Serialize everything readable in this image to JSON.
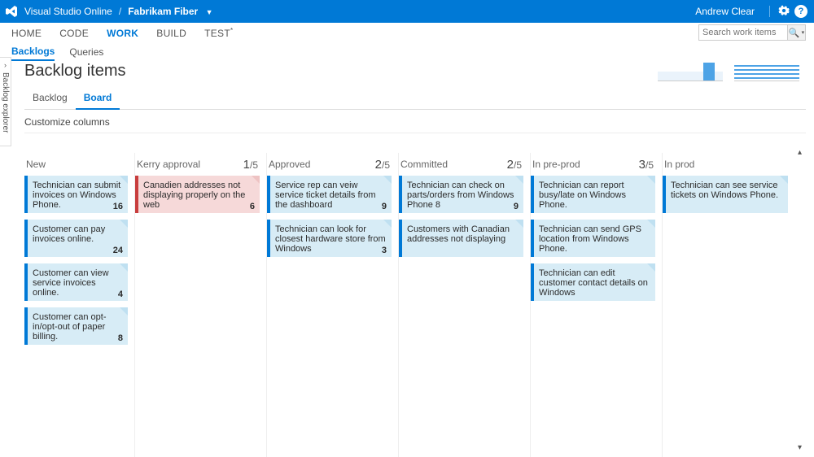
{
  "topbar": {
    "product": "Visual Studio Online",
    "project": "Fabrikam Fiber",
    "user": "Andrew Clear"
  },
  "nav": {
    "items": [
      "HOME",
      "CODE",
      "WORK",
      "BUILD",
      "TEST*"
    ],
    "active": "WORK",
    "search_placeholder": "Search work items"
  },
  "subnav": {
    "items": [
      "Backlogs",
      "Queries"
    ],
    "active": "Backlogs"
  },
  "sidetab": "Backlog explorer",
  "page_title": "Backlog items",
  "viewtabs": {
    "items": [
      "Backlog",
      "Board"
    ],
    "active": "Board"
  },
  "customize": "Customize columns",
  "columns": [
    {
      "name": "New",
      "wip": "",
      "cards": [
        {
          "t": "Technician can submit invoices on Windows Phone.",
          "p": "16"
        },
        {
          "t": "Customer can pay invoices online.",
          "p": "24"
        },
        {
          "t": "Customer can view service invoices online.",
          "p": "4"
        },
        {
          "t": "Customer can opt-in/opt-out of paper billing.",
          "p": "8"
        }
      ]
    },
    {
      "name": "Kerry approval",
      "wip": "1/5",
      "cards": [
        {
          "t": "Canadien addresses not displaying properly on the web",
          "p": "6",
          "red": true
        }
      ]
    },
    {
      "name": "Approved",
      "wip": "2/5",
      "cards": [
        {
          "t": "Service rep can veiw service ticket details from the dashboard",
          "p": "9"
        },
        {
          "t": "Technician can look for closest hardware store from Windows",
          "p": "3"
        }
      ]
    },
    {
      "name": "Committed",
      "wip": "2/5",
      "cards": [
        {
          "t": "Technician can check on parts/orders from Windows Phone 8",
          "p": "9"
        },
        {
          "t": "Customers with Canadian addresses not displaying",
          "p": ""
        }
      ]
    },
    {
      "name": "In pre-prod",
      "wip": "3/5",
      "cards": [
        {
          "t": "Technician can report busy/late on Windows Phone.",
          "p": ""
        },
        {
          "t": "Technician can send GPS location from Windows Phone.",
          "p": ""
        },
        {
          "t": "Technician can edit customer contact details on Windows",
          "p": ""
        }
      ]
    },
    {
      "name": "In prod",
      "wip": "",
      "cards": [
        {
          "t": "Technician can see service tickets on Windows Phone.",
          "p": ""
        }
      ]
    }
  ]
}
